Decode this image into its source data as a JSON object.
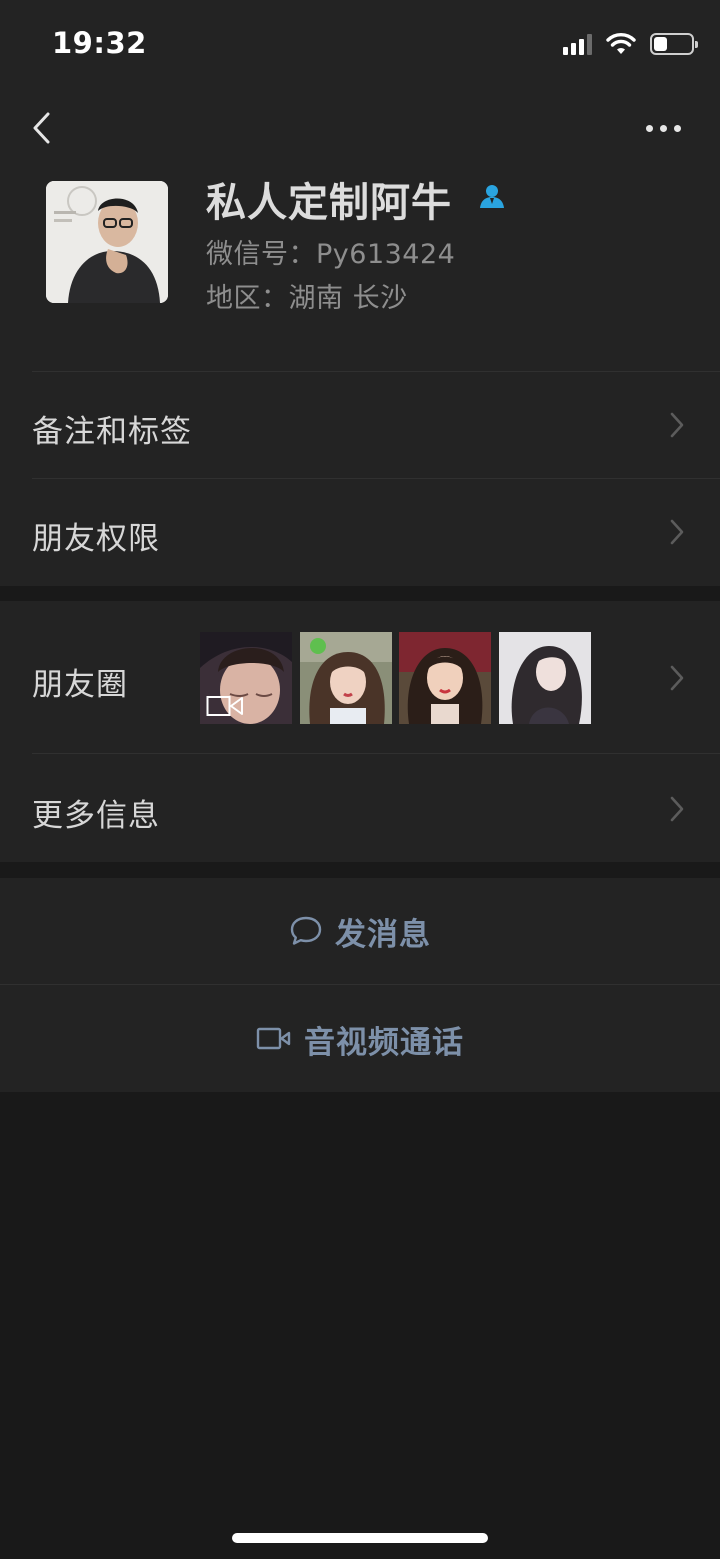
{
  "status_bar": {
    "time": "19:32",
    "battery_level": 0.35
  },
  "nav": {
    "back_icon": "chevron-left-icon",
    "more_icon": "more-dots-icon"
  },
  "profile": {
    "name": "私人定制阿牛",
    "wechat_id": "微信号：Py613424",
    "region": "地区：湖南 长沙",
    "badge_icon": "contact-person-icon",
    "badge_color": "#2aa4e0"
  },
  "menu": {
    "remarks_tags": "备注和标签",
    "friend_permissions": "朋友权限",
    "moments": "朋友圈",
    "more_info": "更多信息"
  },
  "moments_thumbnails": [
    {
      "label": "moment-video-thumbnail",
      "has_video": true
    },
    {
      "label": "moment-photo-thumbnail",
      "has_video": false
    },
    {
      "label": "moment-photo-thumbnail",
      "has_video": false
    },
    {
      "label": "moment-photo-thumbnail",
      "has_video": false
    }
  ],
  "actions": {
    "send_message": "发消息",
    "video_call": "音视频通话",
    "accent_color": "#7d90a9"
  }
}
